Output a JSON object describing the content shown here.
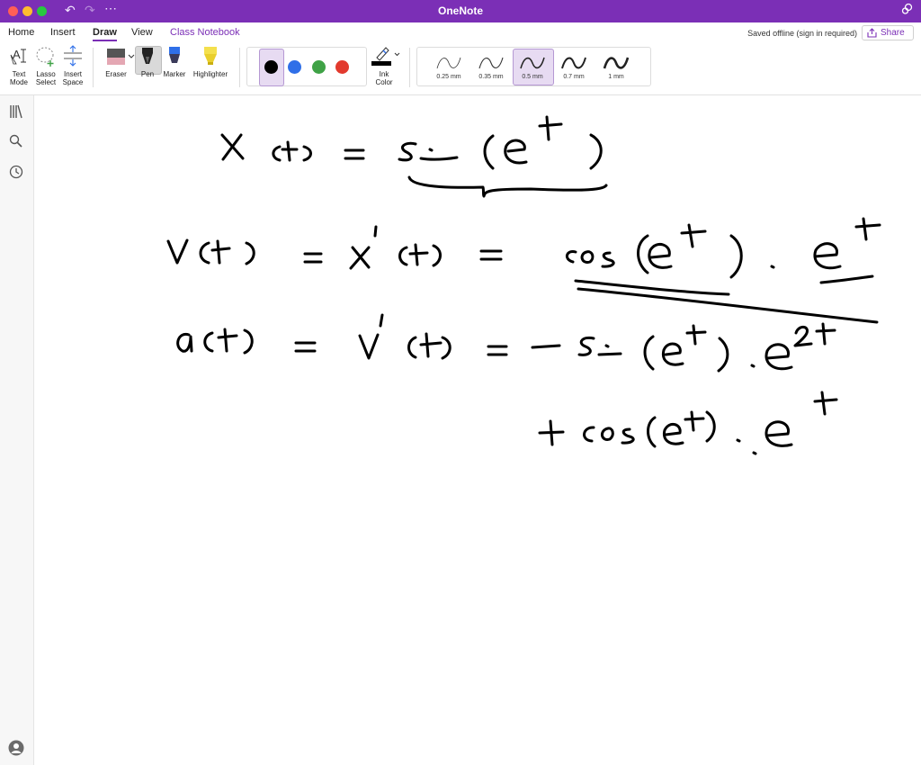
{
  "window": {
    "title": "OneNote",
    "status": "Saved offline (sign in required)",
    "share_label": "Share"
  },
  "tabs": [
    "Home",
    "Insert",
    "Draw",
    "View",
    "Class Notebook"
  ],
  "active_tab": "Draw",
  "ribbon": {
    "text_mode_line1": "Text",
    "text_mode_line2": "Mode",
    "lasso_line1": "Lasso",
    "lasso_line2": "Select",
    "insert_space_line1": "Insert",
    "insert_space_line2": "Space",
    "eraser": "Eraser",
    "pen": "Pen",
    "marker": "Marker",
    "highlighter": "Highlighter",
    "ink_color_line1": "Ink",
    "ink_color_line2": "Color",
    "colors": [
      "#000000",
      "#2f6fe8",
      "#3fa246",
      "#e23a2e"
    ],
    "selected_color": "#000000",
    "thicknesses": [
      "0.25 mm",
      "0.35 mm",
      "0.5 mm",
      "0.7 mm",
      "1 mm"
    ],
    "selected_thickness": "0.5 mm"
  },
  "sidebar_icons": [
    "notebooks-icon",
    "search-icon",
    "recent-icon",
    "account-icon"
  ],
  "accent": "#7b2fb6"
}
